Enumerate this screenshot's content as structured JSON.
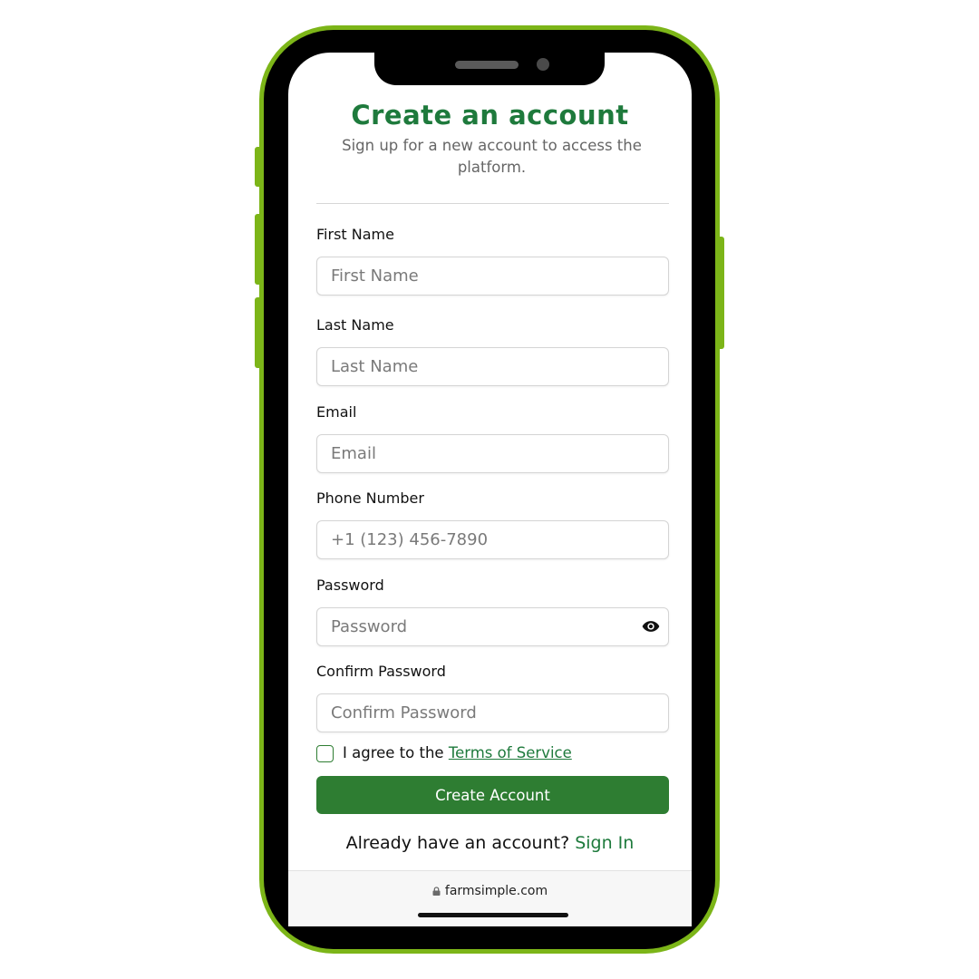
{
  "colors": {
    "frame_accent": "#7cb518",
    "primary_green": "#2e7d32",
    "title_green": "#1e7a3c"
  },
  "header": {
    "title": "Create an account",
    "subtitle": "Sign up for a new account to access the platform."
  },
  "form": {
    "first_name": {
      "label": "First Name",
      "placeholder": "First Name",
      "value": ""
    },
    "last_name": {
      "label": "Last Name",
      "placeholder": "Last Name",
      "value": ""
    },
    "email": {
      "label": "Email",
      "placeholder": "Email",
      "value": ""
    },
    "phone": {
      "label": "Phone Number",
      "placeholder": "+1 (123) 456-7890",
      "value": ""
    },
    "password": {
      "label": "Password",
      "placeholder": "Password",
      "value": "",
      "toggle_icon": "eye-icon"
    },
    "confirm_password": {
      "label": "Confirm Password",
      "placeholder": "Confirm Password",
      "value": ""
    },
    "terms": {
      "checked": false,
      "prefix": "I agree to the ",
      "link": "Terms of Service"
    },
    "submit_label": "Create Account"
  },
  "footer": {
    "prompt": "Already have an account? ",
    "signin_link": "Sign In"
  },
  "browser": {
    "url": "farmsimple.com",
    "lock_icon": "lock-icon"
  }
}
